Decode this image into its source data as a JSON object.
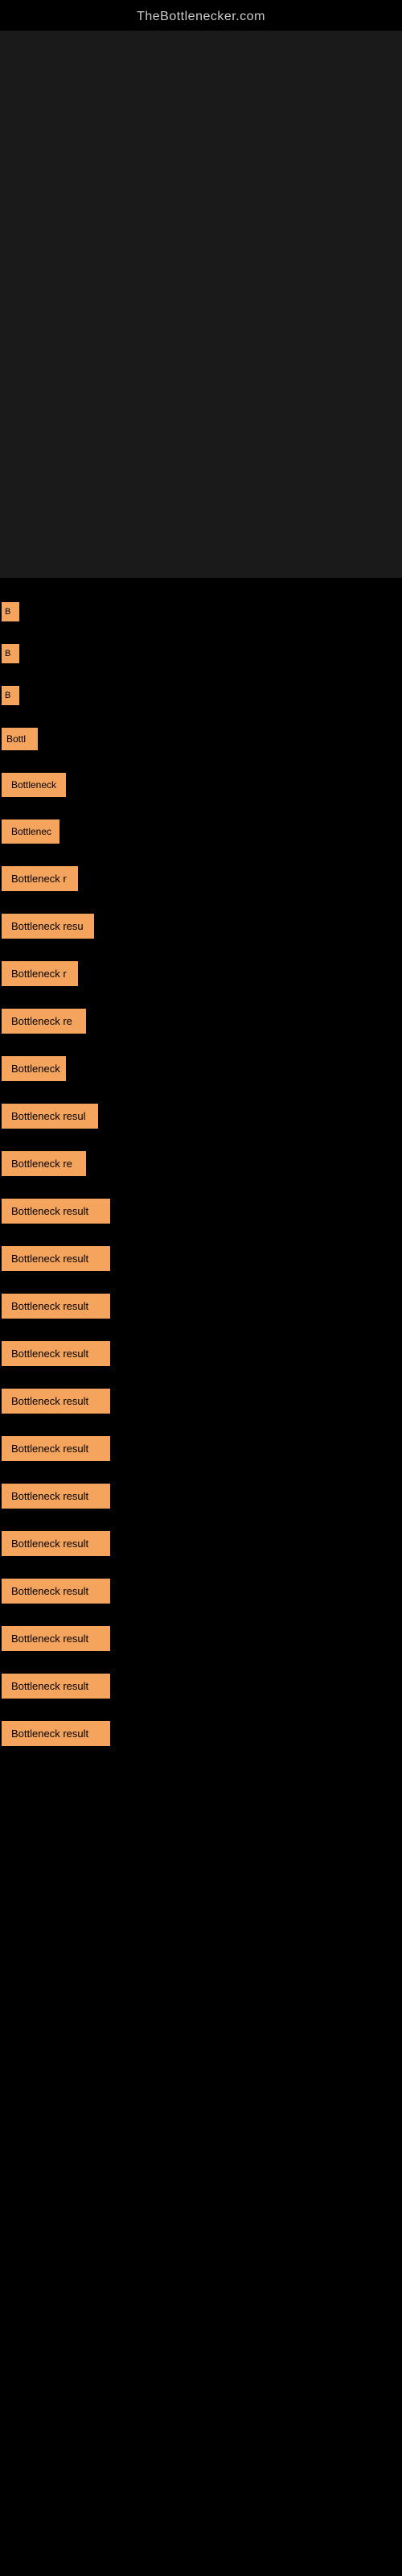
{
  "site": {
    "title": "TheBottlenecker.com"
  },
  "results": [
    {
      "id": 1,
      "label": "B",
      "width": 22,
      "size": "xs"
    },
    {
      "id": 2,
      "label": "B",
      "width": 22,
      "size": "xs"
    },
    {
      "id": 3,
      "label": "B",
      "width": 22,
      "size": "xs"
    },
    {
      "id": 4,
      "label": "Bottl",
      "width": 45,
      "size": "sm"
    },
    {
      "id": 5,
      "label": "Bottleneck",
      "width": 80,
      "size": "md"
    },
    {
      "id": 6,
      "label": "Bottlenec",
      "width": 72,
      "size": "md"
    },
    {
      "id": 7,
      "label": "Bottleneck r",
      "width": 95,
      "size": "lg"
    },
    {
      "id": 8,
      "label": "Bottleneck resu",
      "width": 110,
      "size": "xl"
    },
    {
      "id": 9,
      "label": "Bottleneck r",
      "width": 95,
      "size": "lg"
    },
    {
      "id": 10,
      "label": "Bottleneck re",
      "width": 100,
      "size": "xl"
    },
    {
      "id": 11,
      "label": "Bottleneck",
      "width": 80,
      "size": "md"
    },
    {
      "id": 12,
      "label": "Bottleneck resul",
      "width": 118,
      "size": "xl"
    },
    {
      "id": 13,
      "label": "Bottleneck re",
      "width": 100,
      "size": "xl"
    },
    {
      "id": 14,
      "label": "Bottleneck result",
      "width": 130,
      "size": "xxl"
    },
    {
      "id": 15,
      "label": "Bottleneck result",
      "width": 130,
      "size": "xxl"
    },
    {
      "id": 16,
      "label": "Bottleneck result",
      "width": 130,
      "size": "xxl"
    },
    {
      "id": 17,
      "label": "Bottleneck result",
      "width": 130,
      "size": "xxl"
    },
    {
      "id": 18,
      "label": "Bottleneck result",
      "width": 130,
      "size": "xxl"
    },
    {
      "id": 19,
      "label": "Bottleneck result",
      "width": 130,
      "size": "xxl"
    },
    {
      "id": 20,
      "label": "Bottleneck result",
      "width": 130,
      "size": "xxl"
    },
    {
      "id": 21,
      "label": "Bottleneck result",
      "width": 130,
      "size": "xxl"
    },
    {
      "id": 22,
      "label": "Bottleneck result",
      "width": 130,
      "size": "xxl"
    },
    {
      "id": 23,
      "label": "Bottleneck result",
      "width": 130,
      "size": "xxl"
    },
    {
      "id": 24,
      "label": "Bottleneck result",
      "width": 130,
      "size": "xxl"
    },
    {
      "id": 25,
      "label": "Bottleneck result",
      "width": 130,
      "size": "xxl"
    }
  ],
  "colors": {
    "background": "#000000",
    "badge": "#f5a45d",
    "text_dark": "#000000",
    "site_title": "#cccccc"
  }
}
